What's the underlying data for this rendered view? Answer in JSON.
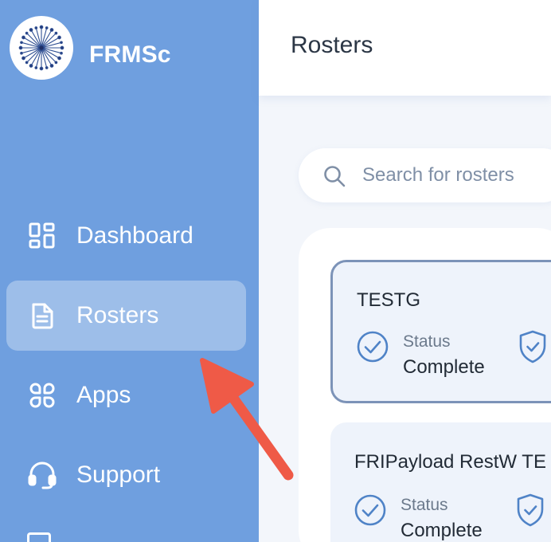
{
  "app": {
    "name": "FRMSc"
  },
  "sidebar": {
    "items": [
      {
        "label": "Dashboard",
        "icon": "dashboard-grid-icon",
        "active": false
      },
      {
        "label": "Rosters",
        "icon": "document-icon",
        "active": true
      },
      {
        "label": "Apps",
        "icon": "apps-icon",
        "active": false
      },
      {
        "label": "Support",
        "icon": "headset-icon",
        "active": false
      }
    ]
  },
  "header": {
    "title": "Rosters"
  },
  "search": {
    "placeholder": "Search for rosters"
  },
  "rosters": [
    {
      "name": "TESTG",
      "status_label": "Status",
      "status_value": "Complete"
    },
    {
      "name": "FRIPayload RestW TE",
      "status_label": "Status",
      "status_value": "Complete"
    }
  ],
  "colors": {
    "sidebar": "#6f9fdf",
    "accent": "#4f83c7",
    "annotation_arrow": "#ef5a47"
  }
}
